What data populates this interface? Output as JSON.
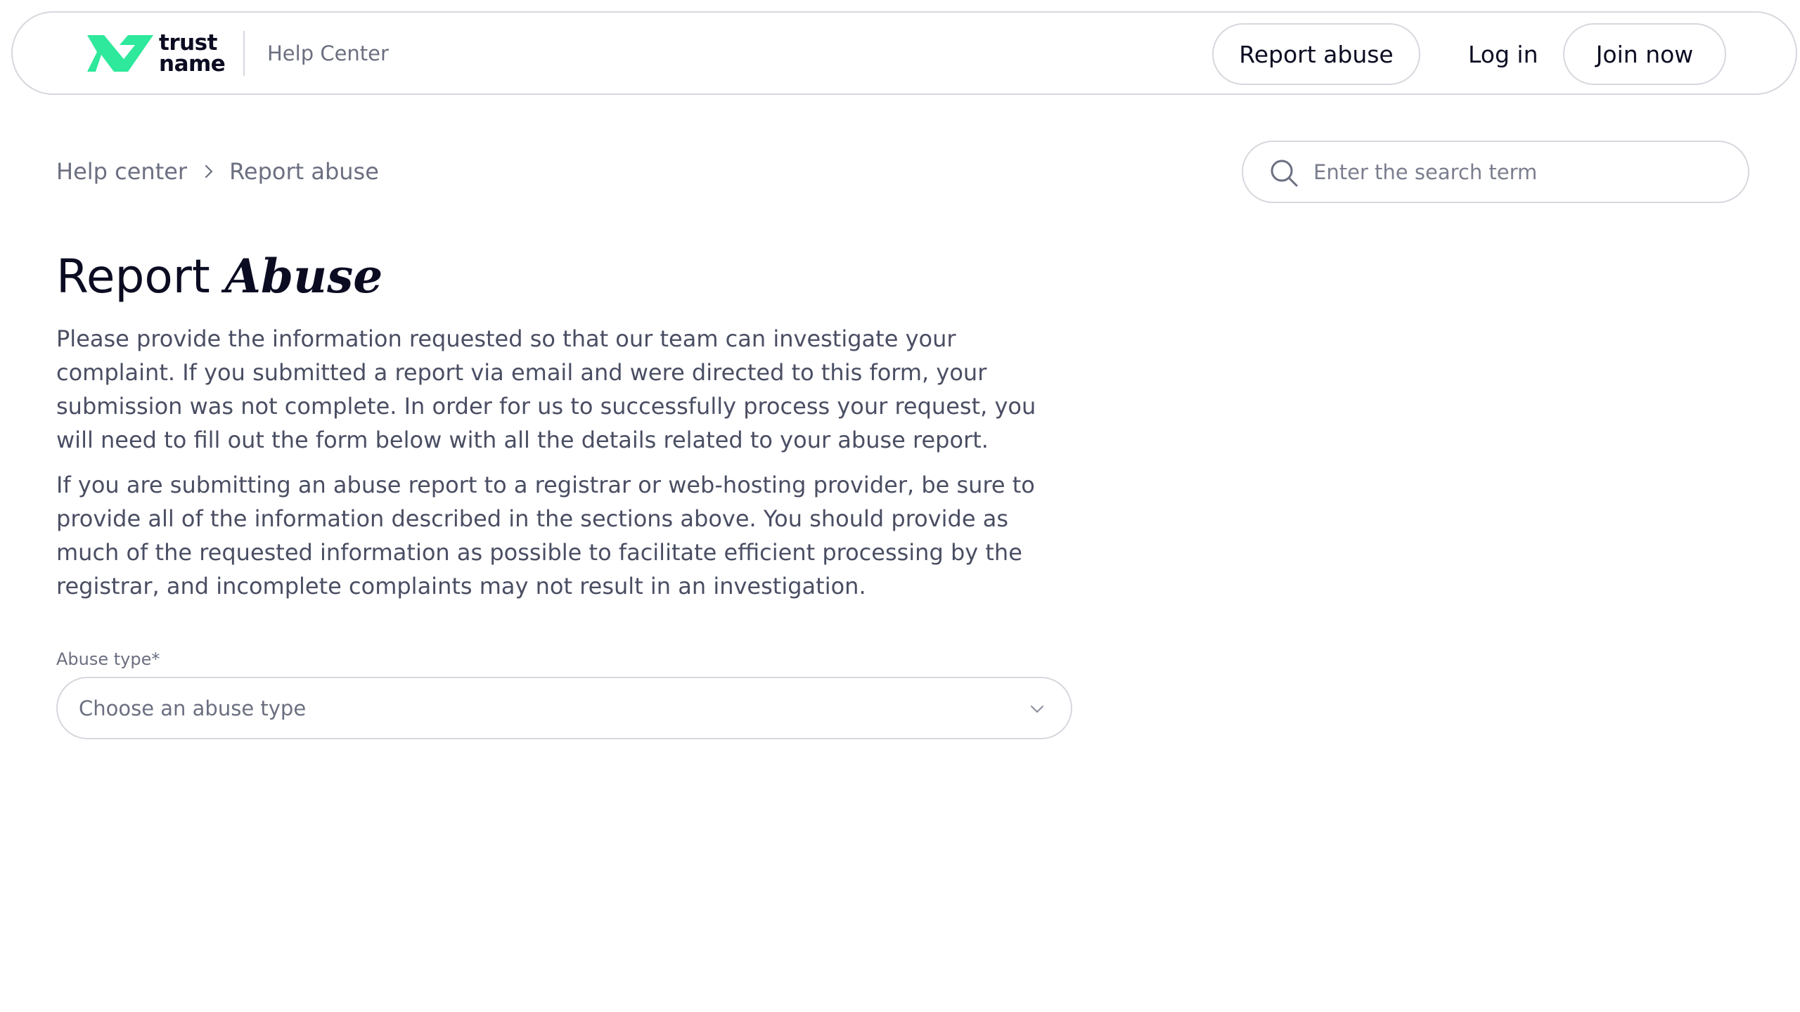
{
  "header": {
    "logo_top": "trust",
    "logo_bottom": "name",
    "section_label": "Help Center",
    "report_abuse_label": "Report abuse",
    "login_label": "Log in",
    "join_label": "Join now",
    "brand_color": "#2ee89b"
  },
  "breadcrumb": {
    "items": [
      "Help center",
      "Report abuse"
    ]
  },
  "search": {
    "placeholder": "Enter the search term",
    "value": ""
  },
  "main": {
    "title_plain": "Report ",
    "title_emphasis": "Abuse",
    "paragraphs": [
      "Please provide the information requested so that our team can investigate your complaint. If you submitted a report via email and were directed to this form, your submission was not complete. In order for us to successfully process your request, you will need to fill out the form below with all the details related to your abuse report.",
      "If you are submitting an abuse report to a registrar or web-hosting provider, be sure to provide all of the information described in the sections above. You should provide as much of the requested information as possible to facilitate efficient processing by the registrar, and incomplete complaints may not result in an investigation."
    ]
  },
  "form": {
    "abuse_type_label": "Abuse type*",
    "abuse_type_value": "Choose an abuse type"
  },
  "icons": {
    "logo": "trustname-logo-icon",
    "breadcrumb_separator": "chevron-right-icon",
    "search": "search-icon",
    "select": "chevron-down-icon"
  }
}
